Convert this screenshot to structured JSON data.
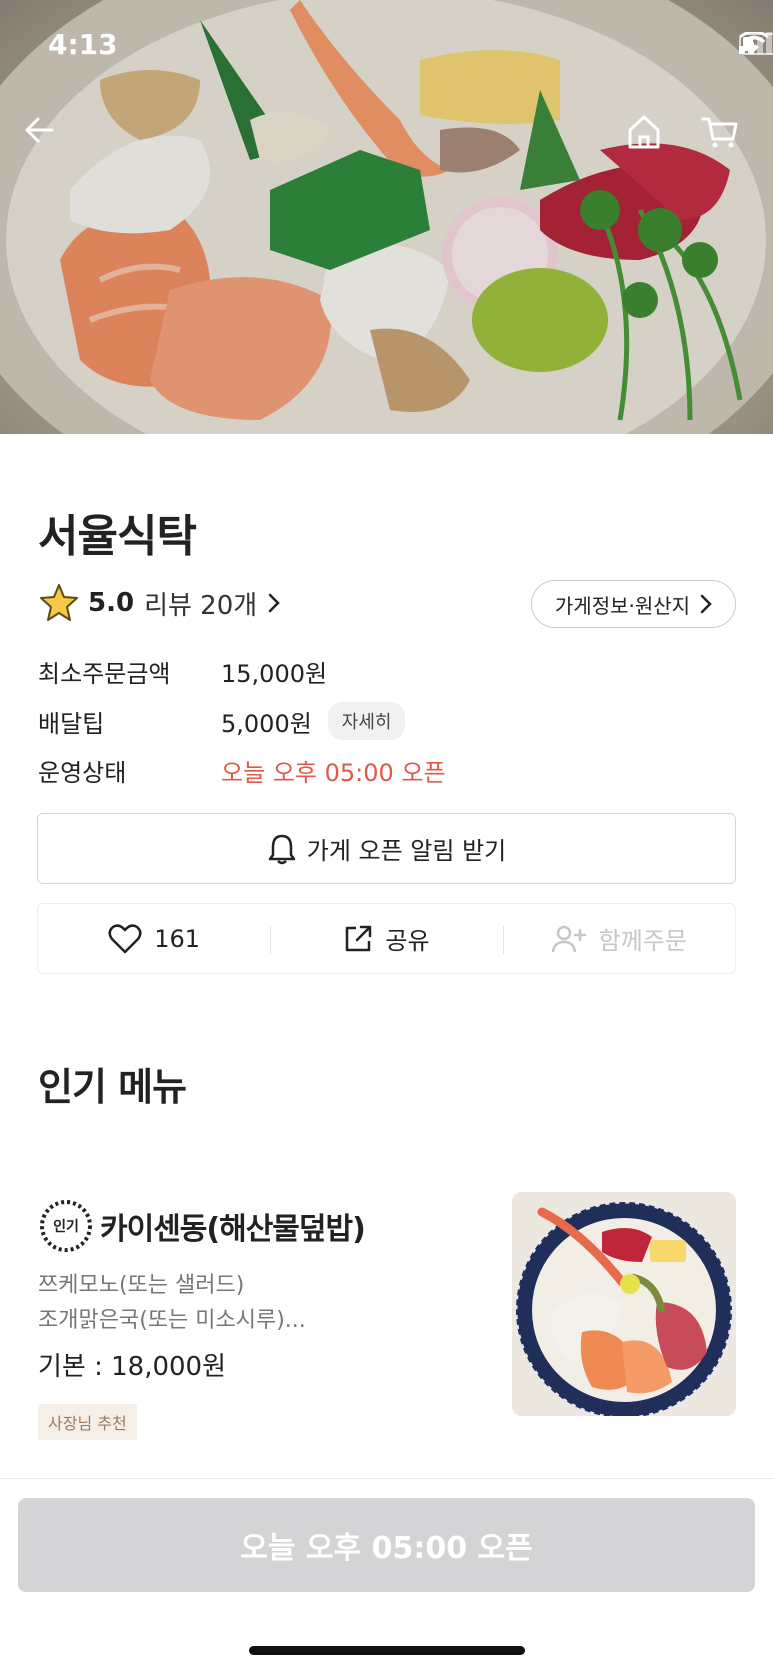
{
  "status_bar": {
    "time": "4:13"
  },
  "store": {
    "name": "서율식탁",
    "rating": "5.0",
    "review_count": "리뷰 20개",
    "info_button": "가게정보·원산지"
  },
  "details": [
    {
      "label": "최소주문금액",
      "value": "15,000원"
    },
    {
      "label": "배달팁",
      "value": "5,000원",
      "chip": "자세히"
    },
    {
      "label": "운영상태",
      "value": "오늘 오후 05:00 오픈"
    }
  ],
  "alarm_button": "가게 오픈 알림 받기",
  "actions": {
    "like_count": "161",
    "share": "공유",
    "group_order": "함께주문"
  },
  "popular_section": {
    "title": "인기 메뉴"
  },
  "menu_item": {
    "badge": "인기",
    "name": "카이센동(해산물덮밥)",
    "desc_line1": "쯔케모노(또는 샐러드)",
    "desc_line2": "조개맑은국(또는 미소시루)...",
    "price": "기본 : 18,000원",
    "tag": "사장님 추천"
  },
  "cta_button": "오늘 오후 05:00 오픈",
  "colors": {
    "accent_red": "#e2574c",
    "cta_disabled": "#d4d4d6",
    "tag_bg": "#f6efe8"
  }
}
